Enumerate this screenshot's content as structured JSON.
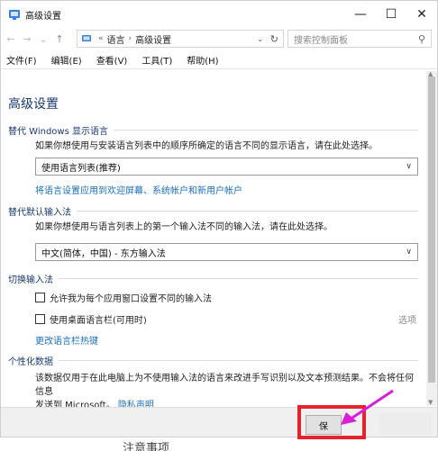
{
  "window": {
    "title": "高级设置",
    "app_icon": "control-panel-icon",
    "controls": {
      "minimize": "—",
      "maximize": "☐",
      "close": "✕"
    }
  },
  "navigation": {
    "back_icon": "←",
    "forward_icon": "→",
    "history_icon": "⌄",
    "up_icon": "↑",
    "breadcrumb": [
      "«",
      "语言",
      "高级设置"
    ],
    "refresh_icon": "↻",
    "search_placeholder": "搜索控制面板",
    "search_icon": "⚲"
  },
  "menu": [
    "文件(F)",
    "编辑(E)",
    "查看(V)",
    "工具(T)",
    "帮助(H)"
  ],
  "content": {
    "page_title": "高级设置",
    "display_language": {
      "header": "替代 Windows 显示语言",
      "description": "如果你想使用与安装语言列表中的顺序所确定的语言不同的显示语言，请在此处选择。",
      "selected": "使用语言列表(推荐)",
      "link": "将语言设置应用到欢迎屏幕、系统帐户和新用户帐户"
    },
    "default_input": {
      "header": "替代默认输入法",
      "description": "如果你想使用与语言列表上的第一个输入法不同的输入法，请在此处选择。",
      "selected": "中文(简体，中国) - 东方输入法"
    },
    "switch_input": {
      "header": "切换输入法",
      "checkbox1": "允许我为每个应用窗口设置不同的输入法",
      "checkbox2": "使用桌面语言栏(可用时)",
      "options": "选项",
      "link": "更改语言栏热键"
    },
    "personalization": {
      "header": "个性化数据",
      "description_line1": "该数据仅用于在此电脑上为不使用输入法的语言来改进手写识别以及文本预测结果。不会将任何信息",
      "description_line2": "发送到 Microsoft。",
      "privacy_link": "隐私声明"
    }
  },
  "footer": {
    "save_label": "保"
  },
  "background_text": "注意事项",
  "colors": {
    "accent": "#1a3a6d",
    "link": "#1a6fb6",
    "highlight": "#e8212e",
    "annotation_arrow": "#d81fd8"
  }
}
